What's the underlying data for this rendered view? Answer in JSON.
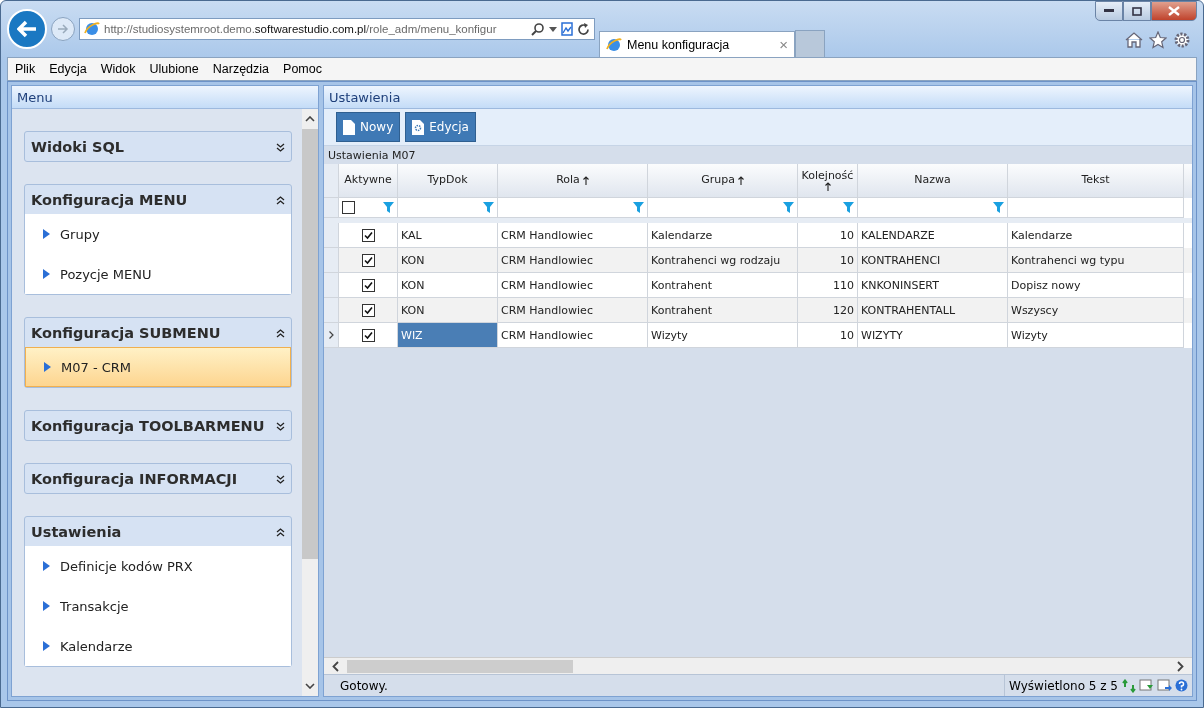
{
  "browser": {
    "url": "http://studiosystemroot.demo.**softwarestudio.com.pl**/role_adm/menu_konfigur",
    "tab_title": "Menu konfiguracja",
    "tab_close": "×"
  },
  "menu_bar": [
    "Plik",
    "Edycja",
    "Widok",
    "Ulubione",
    "Narzędzia",
    "Pomoc"
  ],
  "sidebar": {
    "title": "Menu",
    "sections": [
      {
        "title": "Widoki SQL",
        "expanded": false
      },
      {
        "title": "Konfiguracja MENU",
        "expanded": true,
        "items": [
          {
            "label": "Grupy",
            "selected": false
          },
          {
            "label": "Pozycje MENU",
            "selected": false
          }
        ]
      },
      {
        "title": "Konfiguracja SUBMENU",
        "expanded": true,
        "items": [
          {
            "label": "M07 - CRM",
            "selected": true
          }
        ]
      },
      {
        "title": "Konfiguracja TOOLBARMENU",
        "expanded": false
      },
      {
        "title": "Konfiguracja INFORMACJI",
        "expanded": false
      },
      {
        "title": "Ustawienia",
        "expanded": true,
        "items": [
          {
            "label": "Definicje kodów PRX",
            "selected": false
          },
          {
            "label": "Transakcje",
            "selected": false
          },
          {
            "label": "Kalendarze",
            "selected": false
          }
        ]
      }
    ]
  },
  "main": {
    "title": "Ustawienia",
    "buttons": [
      {
        "label": "Nowy",
        "kind": "new"
      },
      {
        "label": "Edycja",
        "kind": "edit"
      }
    ],
    "grid_caption": "Ustawienia M07",
    "check_column": {
      "label": "Aktywne",
      "filter_checked": false
    },
    "columns": [
      {
        "label": "TypDok",
        "sorted": false
      },
      {
        "label": "Rola",
        "sorted": true
      },
      {
        "label": "Grupa",
        "sorted": true
      },
      {
        "label": "Kolejność",
        "sorted": true
      },
      {
        "label": "Nazwa",
        "sorted": false
      },
      {
        "label": "Tekst",
        "sorted": false
      }
    ],
    "rows": [
      {
        "checked": true,
        "cells": [
          "KAL",
          "CRM Handlowiec",
          "Kalendarze",
          "10",
          "KALENDARZE",
          "Kalendarze"
        ],
        "selected": false
      },
      {
        "checked": true,
        "cells": [
          "KON",
          "CRM Handlowiec",
          "Kontrahenci wg rodzaju",
          "10",
          "KONTRAHENCI",
          "Kontrahenci wg typu"
        ],
        "selected": false
      },
      {
        "checked": true,
        "cells": [
          "KON",
          "CRM Handlowiec",
          "Kontrahent",
          "110",
          "KNKONINSERT",
          "Dopisz nowy"
        ],
        "selected": false
      },
      {
        "checked": true,
        "cells": [
          "KON",
          "CRM Handlowiec",
          "Kontrahent",
          "120",
          "KONTRAHENTALL",
          "Wszyscy"
        ],
        "selected": false
      },
      {
        "checked": true,
        "cells": [
          "WIZ",
          "CRM Handlowiec",
          "Wizyty",
          "10",
          "WIZYTY",
          "Wizyty"
        ],
        "selected": true
      }
    ],
    "status": "Gotowy.",
    "record_count": "Wyświetlono 5 z 5"
  }
}
